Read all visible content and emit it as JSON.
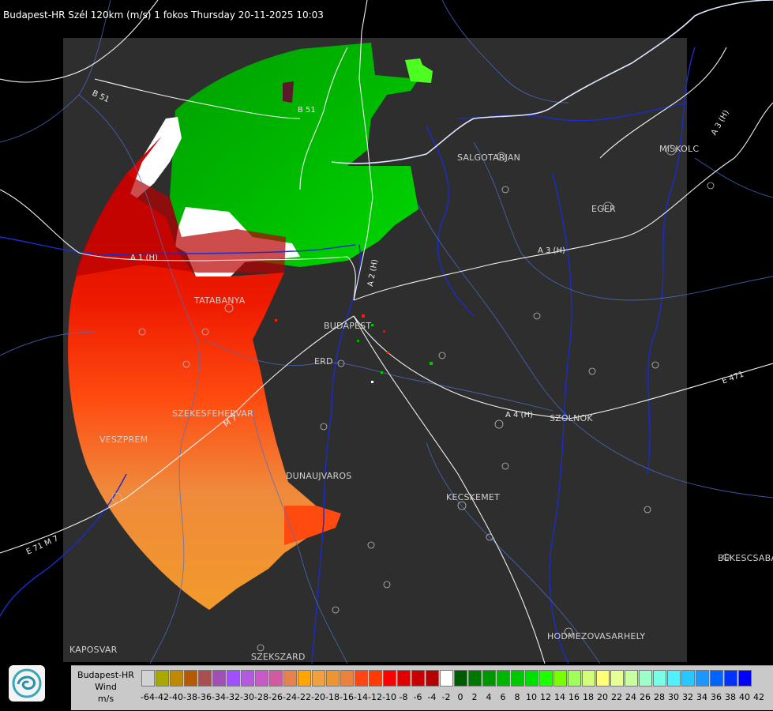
{
  "header": {
    "title": "Budapest-HR Szél 120km (m/s) 1 fokos Thursday 20-11-2025 10:03"
  },
  "cities": [
    {
      "id": "salgotarjan",
      "label": "SALGOTARJAN"
    },
    {
      "id": "miskolc",
      "label": "MISKOLC"
    },
    {
      "id": "eger",
      "label": "EGER"
    },
    {
      "id": "tatabanya",
      "label": "TATABANYA"
    },
    {
      "id": "budapest",
      "label": "BUDAPEST"
    },
    {
      "id": "erd",
      "label": "ERD"
    },
    {
      "id": "szekesfehervar",
      "label": "SZEKESFEHERVAR"
    },
    {
      "id": "veszprem",
      "label": "VESZPREM"
    },
    {
      "id": "szolnok",
      "label": "SZOLNOK"
    },
    {
      "id": "dunaujvaros",
      "label": "DUNAUJVAROS"
    },
    {
      "id": "kecskemet",
      "label": "KECSKEMET"
    },
    {
      "id": "bekescsaba",
      "label": "BEKESCSABA"
    },
    {
      "id": "hodmezovasarhely",
      "label": "HODMEZOVASARHELY"
    },
    {
      "id": "kaposvar",
      "label": "KAPOSVAR"
    },
    {
      "id": "szekszard",
      "label": "SZEKSZARD"
    }
  ],
  "roads": [
    {
      "id": "b51-west",
      "label": "B 51"
    },
    {
      "id": "b51-north",
      "label": "B 51"
    },
    {
      "id": "a1",
      "label": "A 1 (H)"
    },
    {
      "id": "a2",
      "label": "A 2 (H)"
    },
    {
      "id": "a3",
      "label": "A 3 (H)"
    },
    {
      "id": "a3-ne",
      "label": "A 3 (H)"
    },
    {
      "id": "a4",
      "label": "A 4 (H)"
    },
    {
      "id": "e471",
      "label": "E 471"
    },
    {
      "id": "m7",
      "label": "M 7"
    },
    {
      "id": "e71",
      "label": "E 71 M 7"
    }
  ],
  "legend": {
    "station": "Budapest-HR",
    "quantity": "Wind",
    "unit": "m/s",
    "colors": [
      "#d2d2d2",
      "#a8a800",
      "#c08a00",
      "#b45a00",
      "#a85050",
      "#a050b4",
      "#a050ff",
      "#b45ae0",
      "#c85ac8",
      "#d25aa0",
      "#e68250",
      "#ffa500",
      "#f0a03c",
      "#eb9632",
      "#eb823c",
      "#ff4614",
      "#ff3c00",
      "#ff0000",
      "#e00000",
      "#c80000",
      "#b40000",
      "#ffffff",
      "#005a00",
      "#007800",
      "#009600",
      "#00b400",
      "#00c800",
      "#00e000",
      "#1eff00",
      "#78ff00",
      "#a0ff5a",
      "#d2ff78",
      "#ffff78",
      "#e6ff96",
      "#c8ffa0",
      "#a0ffc8",
      "#78ffe6",
      "#50f0ff",
      "#28c8ff",
      "#1e96ff",
      "#0064ff",
      "#0032ff",
      "#0000ff"
    ],
    "ticks": [
      "-64",
      "-42",
      "-40",
      "-38",
      "-36",
      "-34",
      "-32",
      "-30",
      "-28",
      "-26",
      "-24",
      "-22",
      "-20",
      "-18",
      "-16",
      "-14",
      "-12",
      "-10",
      "-8",
      "-6",
      "-4",
      "-2",
      "0",
      "2",
      "4",
      "6",
      "8",
      "10",
      "12",
      "14",
      "16",
      "18",
      "20",
      "22",
      "24",
      "26",
      "28",
      "30",
      "32",
      "34",
      "36",
      "38",
      "40",
      "42"
    ]
  }
}
